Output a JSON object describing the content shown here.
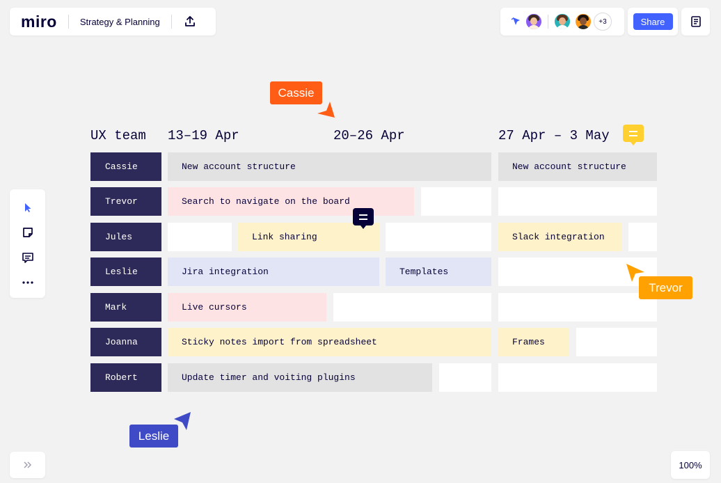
{
  "app": {
    "logo": "miro",
    "board_title": "Strategy & Planning"
  },
  "collaborators": {
    "extra_count": "+3"
  },
  "header": {
    "share_label": "Share"
  },
  "zoom": {
    "level": "100%"
  },
  "board": {
    "headers": {
      "team": "UX team",
      "week1": "13–19 Apr",
      "week2": "20–26 Apr",
      "week3": "27 Apr – 3 May"
    },
    "rows": [
      {
        "name": "Cassie",
        "tasks": [
          "New account structure",
          "New account structure"
        ]
      },
      {
        "name": "Trevor",
        "tasks": [
          "Search to navigate on the board"
        ]
      },
      {
        "name": "Jules",
        "tasks": [
          "Link sharing",
          "Slack integration"
        ]
      },
      {
        "name": "Leslie",
        "tasks": [
          "Jira integration",
          "Templates"
        ]
      },
      {
        "name": "Mark",
        "tasks": [
          "Live cursors"
        ]
      },
      {
        "name": "Joanna",
        "tasks": [
          "Sticky notes import from spreadsheet",
          "Frames"
        ]
      },
      {
        "name": "Robert",
        "tasks": [
          "Update timer and voiting plugins"
        ]
      }
    ]
  },
  "cursors": {
    "cassie": "Cassie",
    "trevor": "Trevor",
    "leslie": "Leslie"
  },
  "colors": {
    "brand_blue": "#4262ff",
    "row_label": "#2d2a59",
    "cassie": "#ff5d16",
    "trevor": "#ffa100",
    "leslie": "#3f4ac6",
    "task_grey": "#e2e2e2",
    "task_pink": "#fde3e3",
    "task_yellow": "#fdf2c9",
    "task_blue": "#e2e5f6"
  },
  "icons": {
    "upload": "upload-icon",
    "notes": "notes-icon",
    "select": "cursor-select-icon",
    "sticky": "sticky-note-icon",
    "comment": "comment-icon",
    "more": "more-icon",
    "expand": "chevrons-right-icon"
  }
}
